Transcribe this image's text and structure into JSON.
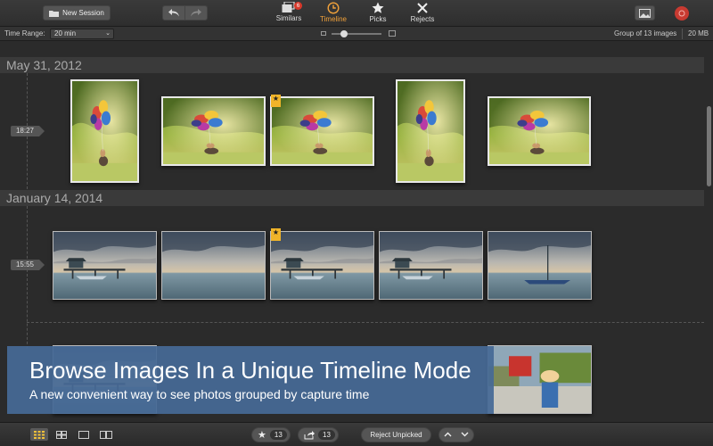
{
  "toolbar": {
    "new_session_label": "New Session",
    "modes": [
      {
        "label": "Similars",
        "badge": "6"
      },
      {
        "label": "Timeline"
      },
      {
        "label": "Picks"
      },
      {
        "label": "Rejects"
      }
    ],
    "active_mode": "Timeline",
    "accent_color": "#f2a23a"
  },
  "subbar": {
    "time_range_label": "Time Range:",
    "time_range_value": "20 min",
    "group_info": "Group of 13 images",
    "size_info": "20 MB"
  },
  "timeline": {
    "sections": [
      {
        "date": "May 31, 2012",
        "groups": [
          {
            "time": "18:27",
            "photo_count": 5,
            "picked_index": 2,
            "subject": "girl-with-balloons"
          }
        ]
      },
      {
        "date": "January 14, 2014",
        "groups": [
          {
            "time": "15:55",
            "photo_count": 5,
            "picked_index": 2,
            "subject": "pier-at-sunset"
          }
        ]
      }
    ]
  },
  "banner": {
    "title": "Browse Images In a Unique Timeline Mode",
    "subtitle": "A new convenient way to see photos grouped by capture time"
  },
  "bottombar": {
    "picks_count": "13",
    "shares_count": "13",
    "reject_unpicked_label": "Reject Unpicked",
    "view_modes": [
      "grid-small",
      "grid-large",
      "single",
      "compare"
    ],
    "active_view": "grid-small"
  }
}
